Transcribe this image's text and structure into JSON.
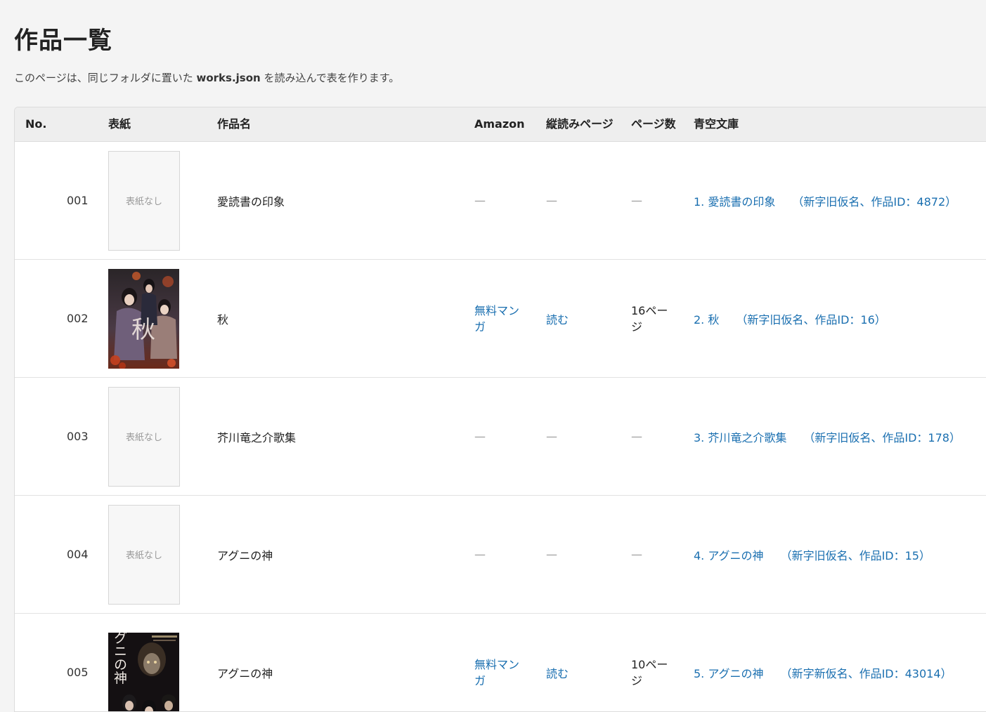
{
  "page": {
    "title": "作品一覧",
    "intro_before": "このページは、同じフォルダに置いた ",
    "intro_file": "works.json",
    "intro_after": " を読み込んで表を作ります。"
  },
  "table": {
    "headers": {
      "no": "No.",
      "cover": "表紙",
      "title": "作品名",
      "amazon": "Amazon",
      "vertical": "縦読みページ",
      "pages": "ページ数",
      "aozora": "青空文庫"
    },
    "rows": [
      {
        "no": "001",
        "cover_text": "表紙なし",
        "title": "愛読書の印象",
        "amazon": "—",
        "vertical": "—",
        "pages": "—",
        "aozora_title": "1. 愛読書の印象",
        "aozora_meta": "（新字旧仮名、作品ID：4872）"
      },
      {
        "no": "002",
        "cover_text": "秋",
        "title": "秋",
        "amazon": "無料マンガ",
        "vertical": "読む",
        "pages": "16ページ",
        "aozora_title": "2. 秋",
        "aozora_meta": "（新字旧仮名、作品ID：16）"
      },
      {
        "no": "003",
        "cover_text": "表紙なし",
        "title": "芥川竜之介歌集",
        "amazon": "—",
        "vertical": "—",
        "pages": "—",
        "aozora_title": "3. 芥川竜之介歌集",
        "aozora_meta": "（新字旧仮名、作品ID：178）"
      },
      {
        "no": "004",
        "cover_text": "表紙なし",
        "title": "アグニの神",
        "amazon": "—",
        "vertical": "—",
        "pages": "—",
        "aozora_title": "4. アグニの神",
        "aozora_meta": "（新字旧仮名、作品ID：15）"
      },
      {
        "no": "005",
        "cover_text": "アグニの神",
        "title": "アグニの神",
        "amazon": "無料マンガ",
        "vertical": "読む",
        "pages": "10ページ",
        "aozora_title": "5. アグニの神",
        "aozora_meta": "（新字新仮名、作品ID：43014）"
      }
    ]
  },
  "colors": {
    "link": "#1a6fb0",
    "background": "#f4f4f4",
    "header_bg": "#eeeeee"
  }
}
